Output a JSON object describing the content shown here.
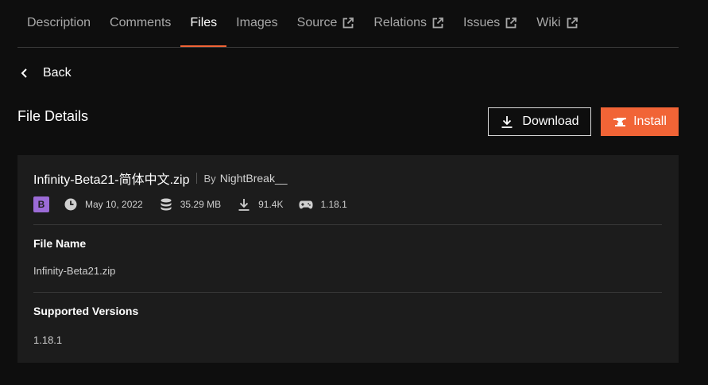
{
  "tabs": [
    {
      "label": "Description",
      "active": false,
      "external": false
    },
    {
      "label": "Comments",
      "active": false,
      "external": false
    },
    {
      "label": "Files",
      "active": true,
      "external": false
    },
    {
      "label": "Images",
      "active": false,
      "external": false
    },
    {
      "label": "Source",
      "active": false,
      "external": true
    },
    {
      "label": "Relations",
      "active": false,
      "external": true
    },
    {
      "label": "Issues",
      "active": false,
      "external": true
    },
    {
      "label": "Wiki",
      "active": false,
      "external": true
    }
  ],
  "nav": {
    "back_label": "Back"
  },
  "page": {
    "title": "File Details"
  },
  "actions": {
    "download_label": "Download",
    "install_label": "Install"
  },
  "file": {
    "display_name": "Infinity-Beta21-简体中文.zip",
    "by_label": "By",
    "author": "NightBreak__",
    "release_badge": "B",
    "date": "May 10, 2022",
    "size": "35.29 MB",
    "downloads": "91.4K",
    "game_version": "1.18.1"
  },
  "details": {
    "file_name_label": "File Name",
    "file_name_value": "Infinity-Beta21.zip",
    "versions_label": "Supported Versions",
    "versions_value": "1.18.1"
  },
  "colors": {
    "accent": "#f16436",
    "badge_beta": "#9b6bd6",
    "card_bg": "#1c1c1c",
    "page_bg": "#0e0e0e"
  },
  "icons": [
    "external-link-icon",
    "chevron-left-icon",
    "download-icon",
    "anvil-icon",
    "clock-icon",
    "database-icon",
    "gamepad-icon"
  ]
}
